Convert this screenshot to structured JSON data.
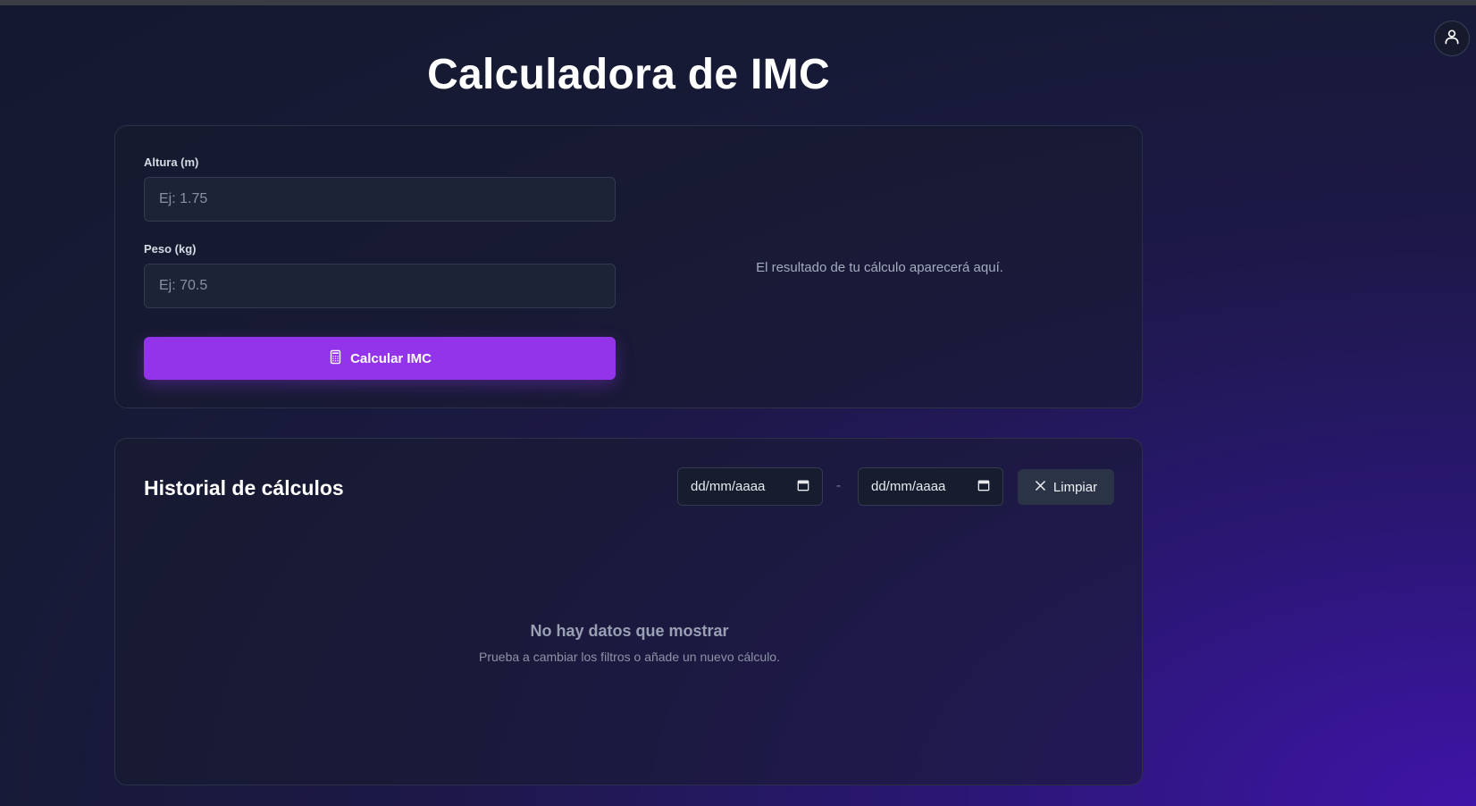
{
  "page": {
    "title": "Calculadora de IMC"
  },
  "header": {
    "user_icon": "user-icon"
  },
  "calculator": {
    "height_label": "Altura (m)",
    "height_placeholder": "Ej: 1.75",
    "height_value": "",
    "weight_label": "Peso (kg)",
    "weight_placeholder": "Ej: 70.5",
    "weight_value": "",
    "submit_label": "Calcular IMC",
    "submit_icon": "calculator-icon",
    "result_placeholder": "El resultado de tu cálculo aparecerá aquí."
  },
  "history": {
    "title": "Historial de cálculos",
    "date_from": "dd/mm/aaaa",
    "date_separator": "-",
    "date_to": "dd/mm/aaaa",
    "calendar_icon": "calendar-icon",
    "clear_label": "Limpiar",
    "clear_icon": "close-icon",
    "empty_title": "No hay datos que mostrar",
    "empty_subtitle": "Prueba a cambiar los filtros o añade un nuevo cálculo."
  },
  "colors": {
    "accent": "#9333ea",
    "background_dark": "#141830",
    "background_glow": "#3f14a8",
    "card_border": "#2c3147",
    "input_bg": "#1c2336",
    "secondary_button": "#2b3347"
  }
}
